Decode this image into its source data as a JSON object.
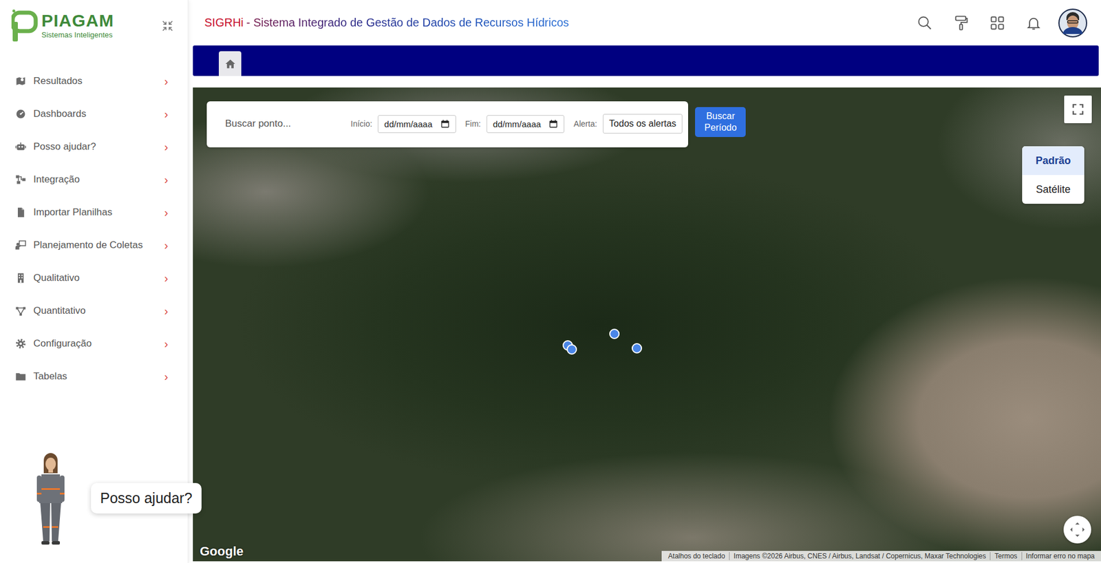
{
  "logo": {
    "name": "PIAGAM",
    "tagline": "Sistemas Inteligentes"
  },
  "sidebar": {
    "chevron": "›",
    "items": [
      {
        "label": "Resultados"
      },
      {
        "label": "Dashboards"
      },
      {
        "label": "Posso ajudar?"
      },
      {
        "label": "Integração"
      },
      {
        "label": "Importar Planilhas"
      },
      {
        "label": "Planejamento de Coletas"
      },
      {
        "label": "Qualitativo"
      },
      {
        "label": "Quantitativo"
      },
      {
        "label": "Configuração"
      },
      {
        "label": "Tabelas"
      }
    ]
  },
  "assistant": {
    "bubble": "Posso ajudar?"
  },
  "header": {
    "brand": "SIGRHi",
    "title": "- Sistema Integrado de Gestão de Dados de Recursos Hídricos"
  },
  "home_tab": {
    "selected": true
  },
  "map": {
    "search_placeholder": "Buscar ponto...",
    "start_label": "Início:",
    "start_placeholder": "dd/mm/aaaa",
    "end_label": "Fim:",
    "end_placeholder": "dd/mm/aaaa",
    "alert_label": "Alerta:",
    "alert_value": "Todos os alertas",
    "search_button": "Buscar Período",
    "map_types": [
      {
        "label": "Padrão",
        "selected": true
      },
      {
        "label": "Satélite",
        "selected": false
      }
    ],
    "google": "Google",
    "attribution": [
      "Atalhos do teclado",
      "Imagens ©2026 Airbus, CNES / Airbus, Landsat / Copernicus, Maxar Technologies",
      "Termos",
      "Informar erro no mapa"
    ]
  }
}
